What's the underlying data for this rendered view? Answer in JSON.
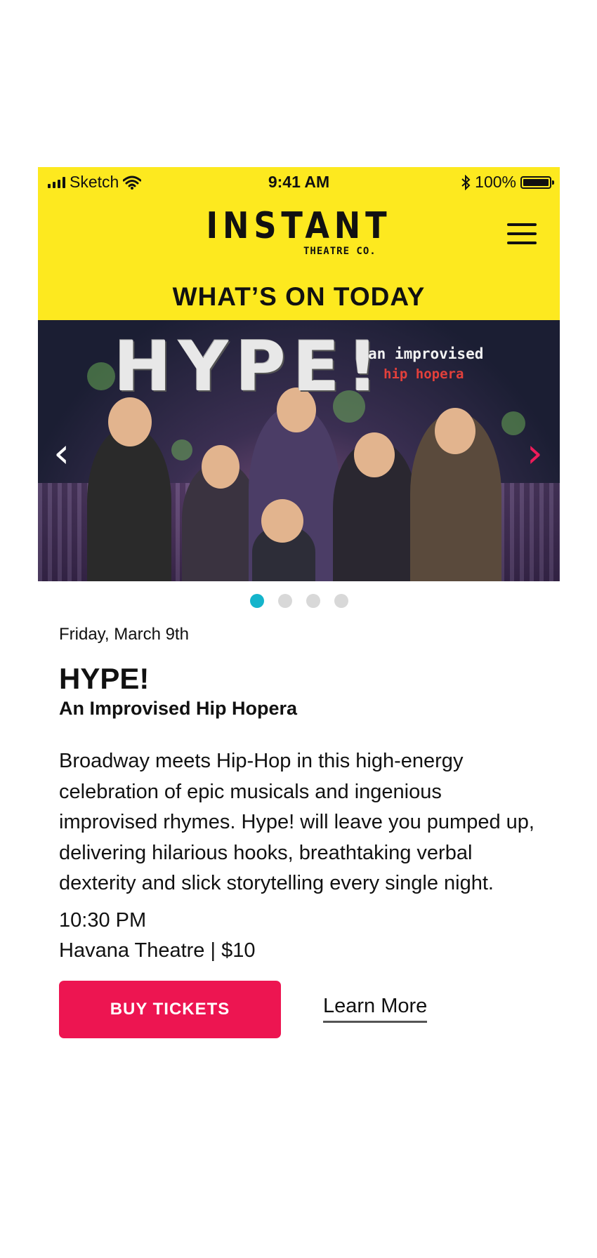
{
  "status_bar": {
    "carrier": "Sketch",
    "time": "9:41 AM",
    "battery": "100%"
  },
  "header": {
    "brand": "INSTANT",
    "brand_sub": "THEATRE CO.",
    "section_title": "WHAT’S ON TODAY"
  },
  "hero": {
    "title": "HYPE!",
    "tagline_line1": "an improvised",
    "tagline_line2": "hip hopera",
    "prev_arrow": "‹",
    "next_arrow": "›",
    "slide_count": 4,
    "active_slide": 1
  },
  "event": {
    "date": "Friday, March 9th",
    "title": "HYPE!",
    "subtitle": "An Improvised Hip Hopera",
    "description": "Broadway meets Hip-Hop in this high-energy celebration of epic musicals and ingenious improvised rhymes. Hype! will leave you pumped up, delivering hilarious hooks, breathtaking verbal dexterity and slick storytelling every single night.",
    "time": "10:30 PM",
    "venue_price": "Havana Theatre | $10"
  },
  "actions": {
    "buy_label": "BUY TICKETS",
    "learn_label": "Learn More"
  },
  "colors": {
    "header_yellow": "#fde91f",
    "buy_button": "#ed1551",
    "active_dot": "#14b4cb",
    "next_arrow": "#ee1c5a"
  },
  "icons": [
    "signal-bars-icon",
    "wifi-icon",
    "bluetooth-icon",
    "battery-icon",
    "hamburger-menu-icon",
    "chevron-left-icon",
    "chevron-right-icon"
  ]
}
